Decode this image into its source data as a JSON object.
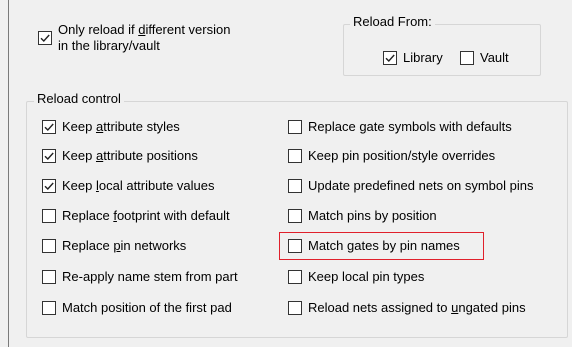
{
  "top": {
    "only_reload": {
      "line1_pre": "Only reload if ",
      "line1_u": "d",
      "line1_post": "ifferent version",
      "line2": "in the library/vault",
      "checked": true
    }
  },
  "reload_from": {
    "title": "Reload From:",
    "library": {
      "label": "Library",
      "checked": true
    },
    "vault": {
      "label": "Vault",
      "checked": false
    }
  },
  "reload_control": {
    "title": "Reload control",
    "left": [
      {
        "pre": "Keep ",
        "u": "a",
        "post": "ttribute styles",
        "checked": true
      },
      {
        "pre": "Keep ",
        "u": "a",
        "post": "ttribute positions",
        "checked": true
      },
      {
        "pre": "Keep ",
        "u": "l",
        "post": "ocal attribute values",
        "checked": true
      },
      {
        "pre": "Replace ",
        "u": "f",
        "post": "ootprint with default",
        "checked": false
      },
      {
        "pre": "Replace ",
        "u": "p",
        "post": "in networks",
        "checked": false
      },
      {
        "pre": "Re-apply name stem from part",
        "u": "",
        "post": "",
        "checked": false
      },
      {
        "pre": "Match position of the first pad",
        "u": "",
        "post": "",
        "checked": false
      }
    ],
    "right": [
      {
        "pre": "Replace ",
        "u": "g",
        "post": "ate symbols with defaults",
        "checked": false
      },
      {
        "pre": "Keep pin position/style overrides",
        "u": "",
        "post": "",
        "checked": false
      },
      {
        "pre": "Update predefined nets on symbol pins",
        "u": "",
        "post": "",
        "checked": false
      },
      {
        "pre": "Match pins by position",
        "u": "",
        "post": "",
        "checked": false
      },
      {
        "pre": "Match gates by pin names",
        "u": "",
        "post": "",
        "checked": false
      },
      {
        "pre": "Keep local pin types",
        "u": "",
        "post": "",
        "checked": false
      },
      {
        "pre": "Reload nets assigned to ",
        "u": "u",
        "post": "ngated pins",
        "checked": false
      }
    ]
  },
  "highlight_color": "#e0202b"
}
